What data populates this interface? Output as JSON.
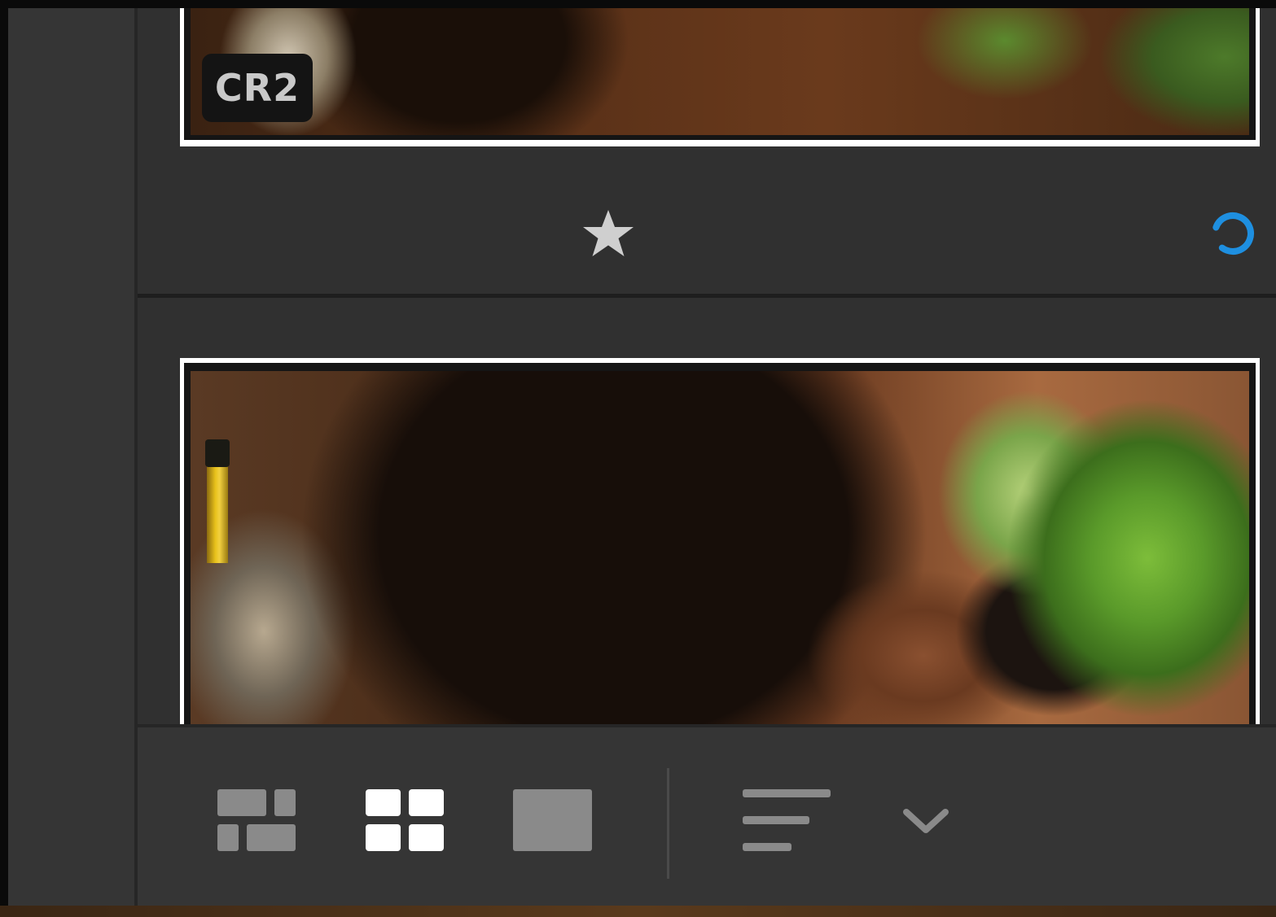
{
  "thumbnails": [
    {
      "format_badge": "CR2",
      "rating_icon": "star-icon",
      "status_icon": "loading-spinner-icon"
    },
    {
      "format_badge": ""
    }
  ],
  "toolbar": {
    "view_buttons": [
      {
        "icon": "square-grid-view-icon",
        "active": false
      },
      {
        "icon": "grid-view-icon",
        "active": true
      },
      {
        "icon": "detail-view-icon",
        "active": false
      }
    ],
    "sort_icon": "sort-lines-icon",
    "sort_menu_icon": "chevron-down-icon"
  },
  "colors": {
    "accent_spinner": "#1e8fe0",
    "panel_bg": "#303030",
    "toolbar_bg": "#353535"
  }
}
